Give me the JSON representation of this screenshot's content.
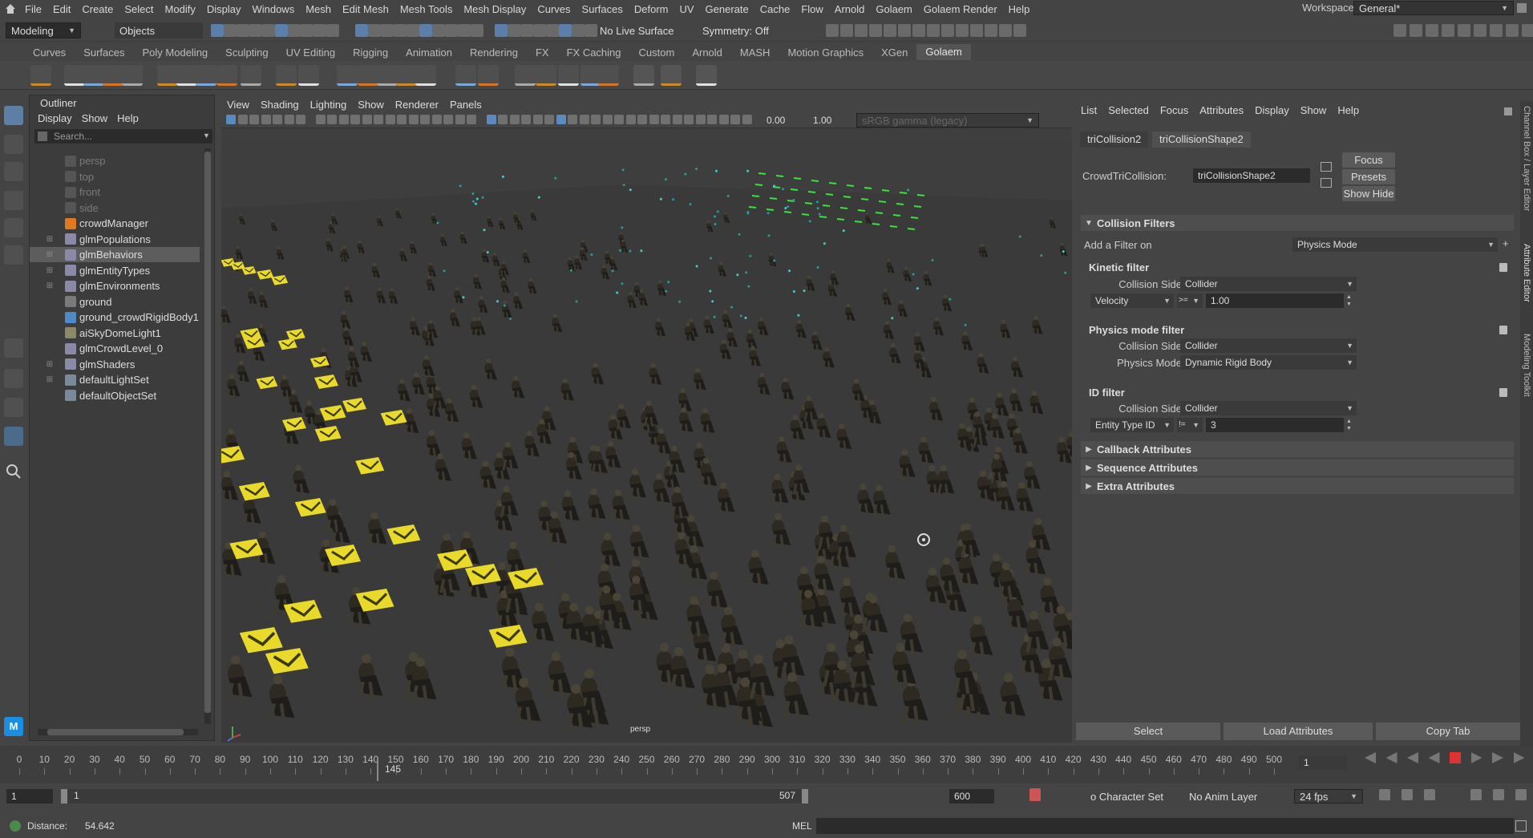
{
  "menubar": [
    "File",
    "Edit",
    "Create",
    "Select",
    "Modify",
    "Display",
    "Windows",
    "Mesh",
    "Edit Mesh",
    "Mesh Tools",
    "Mesh Display",
    "Curves",
    "Surfaces",
    "Deform",
    "UV",
    "Generate",
    "Cache",
    "Flow",
    "Arnold",
    "Golaem",
    "Golaem Render",
    "Help"
  ],
  "workspace": {
    "label": "Workspace:",
    "value": "General*"
  },
  "statusline": {
    "mode": "Modeling",
    "objects": "Objects",
    "live_surface": "No Live Surface",
    "symmetry": "Symmetry: Off"
  },
  "shelf_tabs": [
    "Curves",
    "Surfaces",
    "Poly Modeling",
    "Sculpting",
    "UV Editing",
    "Rigging",
    "Animation",
    "Rendering",
    "FX",
    "FX Caching",
    "Custom",
    "Arnold",
    "MASH",
    "Motion Graphics",
    "XGen",
    "Golaem"
  ],
  "shelf_active": "Golaem",
  "outliner": {
    "title": "Outliner",
    "menu": [
      "Display",
      "Show",
      "Help"
    ],
    "search_placeholder": "Search...",
    "items": [
      {
        "label": "persp",
        "icon": "camera-icon",
        "expand": false,
        "dim": true,
        "selected": false
      },
      {
        "label": "top",
        "icon": "camera-icon",
        "expand": false,
        "dim": true,
        "selected": false
      },
      {
        "label": "front",
        "icon": "camera-icon",
        "expand": false,
        "dim": true,
        "selected": false
      },
      {
        "label": "side",
        "icon": "camera-icon",
        "expand": false,
        "dim": true,
        "selected": false
      },
      {
        "label": "crowdManager",
        "icon": "crowd-manager-icon",
        "expand": false,
        "dim": false,
        "selected": false
      },
      {
        "label": "glmPopulations",
        "icon": "golaem-icon",
        "expand": true,
        "dim": false,
        "selected": false
      },
      {
        "label": "glmBehaviors",
        "icon": "golaem-icon",
        "expand": true,
        "dim": false,
        "selected": true
      },
      {
        "label": "glmEntityTypes",
        "icon": "golaem-icon",
        "expand": true,
        "dim": false,
        "selected": false
      },
      {
        "label": "glmEnvironments",
        "icon": "golaem-icon",
        "expand": true,
        "dim": false,
        "selected": false
      },
      {
        "label": "ground",
        "icon": "mesh-icon",
        "expand": false,
        "dim": false,
        "selected": false
      },
      {
        "label": "ground_crowdRigidBody1",
        "icon": "rigid-body-icon",
        "expand": false,
        "dim": false,
        "selected": false
      },
      {
        "label": "aiSkyDomeLight1",
        "icon": "light-icon",
        "expand": false,
        "dim": false,
        "selected": false
      },
      {
        "label": "glmCrowdLevel_0",
        "icon": "golaem-icon",
        "expand": false,
        "dim": false,
        "selected": false
      },
      {
        "label": "glmShaders",
        "icon": "golaem-icon",
        "expand": true,
        "dim": false,
        "selected": false
      },
      {
        "label": "defaultLightSet",
        "icon": "set-icon",
        "expand": true,
        "dim": false,
        "selected": false
      },
      {
        "label": "defaultObjectSet",
        "icon": "set-icon",
        "expand": false,
        "dim": false,
        "selected": false
      }
    ]
  },
  "viewport": {
    "menu": [
      "View",
      "Shading",
      "Lighting",
      "Show",
      "Renderer",
      "Panels"
    ],
    "exposure": "0.00",
    "gamma": "1.00",
    "colorspace": "sRGB gamma (legacy)",
    "camera_label": "persp"
  },
  "attribute_editor": {
    "menu": [
      "List",
      "Selected",
      "Focus",
      "Attributes",
      "Display",
      "Show",
      "Help"
    ],
    "tabs": [
      "triCollision2",
      "triCollisionShape2"
    ],
    "active_tab": 1,
    "node_label": "CrowdTriCollision:",
    "node_value": "triCollisionShape2",
    "buttons": {
      "focus": "Focus",
      "presets": "Presets",
      "show_hide": "Show Hide"
    },
    "collision_filters": {
      "title": "Collision Filters",
      "add_label": "Add a Filter on",
      "add_value": "Physics Mode",
      "kinetic": {
        "title": "Kinetic filter",
        "side_label": "Collision Side",
        "side_value": "Collider",
        "prop": "Velocity",
        "op": ">=",
        "value": "1.00"
      },
      "physics": {
        "title": "Physics mode filter",
        "side_label": "Collision Side",
        "side_value": "Collider",
        "mode_label": "Physics Mode",
        "mode_value": "Dynamic Rigid Body"
      },
      "id": {
        "title": "ID filter",
        "side_label": "Collision Side",
        "side_value": "Collider",
        "prop": "Entity Type ID",
        "op": "!=",
        "value": "3"
      }
    },
    "sections": [
      "Callback Attributes",
      "Sequence Attributes",
      "Extra Attributes"
    ],
    "bottom": {
      "select": "Select",
      "load": "Load Attributes",
      "copy": "Copy Tab"
    },
    "side_tabs": [
      "Channel Box / Layer Editor",
      "Attribute Editor",
      "Modeling Toolkit"
    ]
  },
  "timeline": {
    "ticks": [
      "0",
      "10",
      "20",
      "30",
      "40",
      "50",
      "60",
      "70",
      "80",
      "90",
      "100",
      "110",
      "120",
      "130",
      "140",
      "150",
      "160",
      "170",
      "180",
      "190",
      "200",
      "210",
      "220",
      "230",
      "240",
      "250",
      "260",
      "270",
      "280",
      "290",
      "300",
      "310",
      "320",
      "330",
      "340",
      "350",
      "360",
      "370",
      "380",
      "390",
      "400",
      "410",
      "420",
      "430",
      "440",
      "450",
      "460",
      "470",
      "480",
      "490",
      "500"
    ],
    "current": "145",
    "current_frame_field": "1"
  },
  "range": {
    "start": "1",
    "inner_start": "1",
    "inner_end": "507",
    "end": "600",
    "character_set": "o Character Set",
    "anim_layer": "No Anim Layer",
    "fps": "24 fps"
  },
  "cmd": {
    "distance_label": "Distance:",
    "distance_value": "54.642",
    "lang": "MEL"
  }
}
